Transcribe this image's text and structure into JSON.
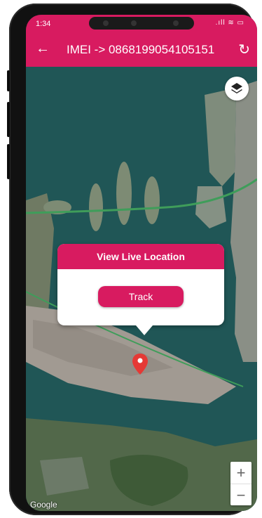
{
  "status_bar": {
    "time": "1:34",
    "icons_text": ".ıll ≋ ▭"
  },
  "app_bar": {
    "back_icon": "←",
    "title": "IMEI -> 0868199054105151",
    "refresh_icon": "↻"
  },
  "popup": {
    "title": "View Live Location",
    "button_label": "Track"
  },
  "map": {
    "layers_icon": "layers-icon",
    "zoom_in": "+",
    "zoom_out": "−",
    "attribution": "Google"
  },
  "colors": {
    "accent": "#d81b60",
    "water": "#1d4d4f",
    "marker": "#e53935"
  }
}
